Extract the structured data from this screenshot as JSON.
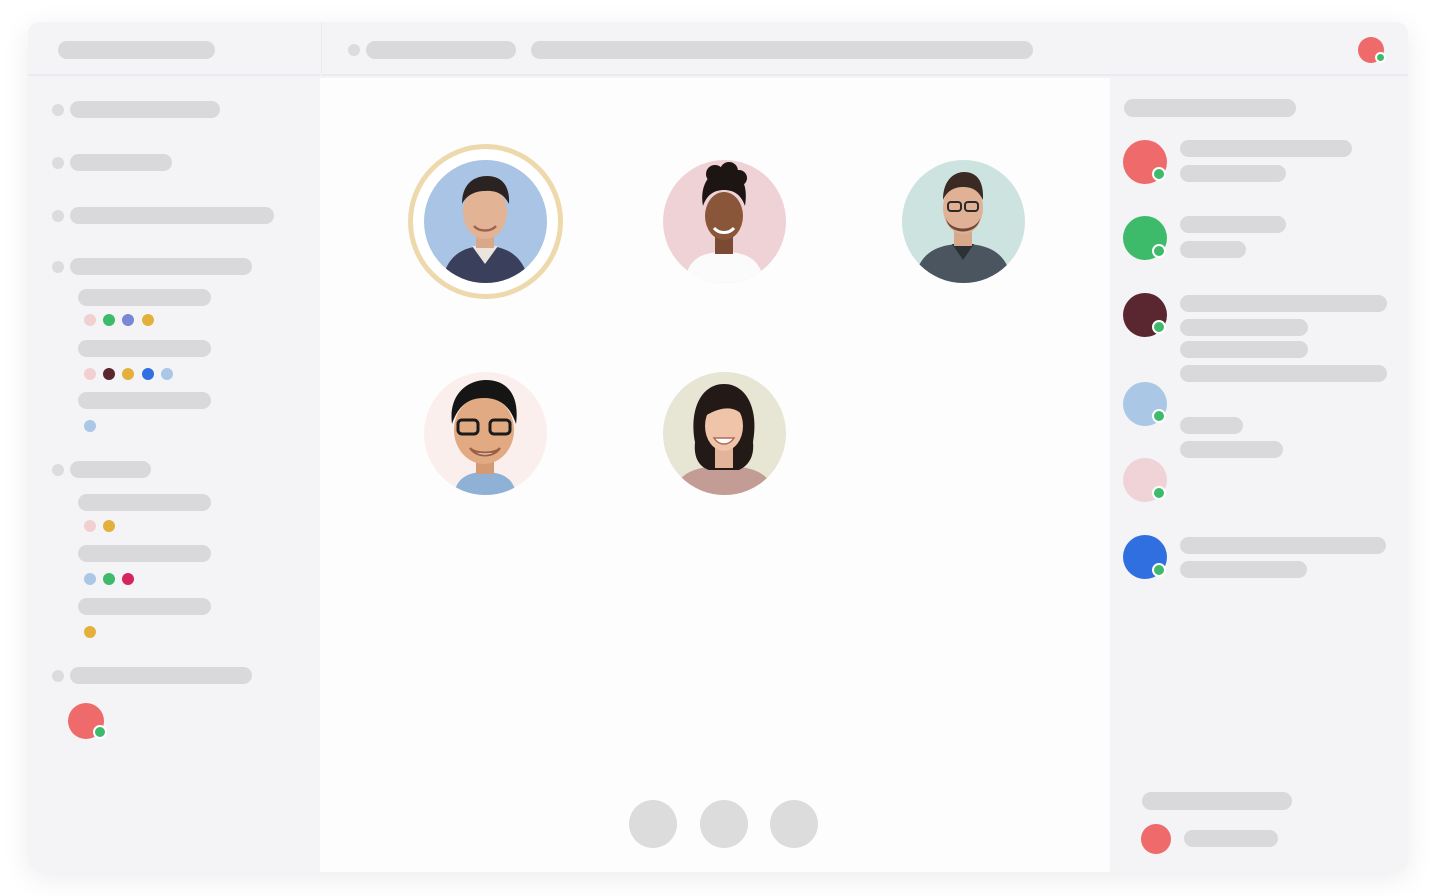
{
  "colors": {
    "window_bg": "#f4f4f6",
    "stage_bg": "#fdfdfd",
    "placeholder": "#d9d9dc",
    "online": "#3dbb6b",
    "speaking_ring": "#eed9ad"
  },
  "user_avatar": {
    "color": "#ef6a6a",
    "online": true
  },
  "channels": [
    {
      "color_dots": [
        "#f2d0d2",
        "#3dbb6b",
        "#7a86d6",
        "#e3b03c"
      ]
    },
    {
      "color_dots": [
        "#f2d0d2",
        "#5a2730",
        "#e3b03c",
        "#2f6fe0",
        "#aac7e6"
      ]
    },
    {
      "color_dots": [
        "#aac7e6"
      ]
    },
    {
      "color_dots": [
        "#f2d0d2",
        "#e3b03c"
      ]
    },
    {
      "color_dots": [
        "#aac7e6",
        "#3dbb6b",
        "#d7245c"
      ]
    },
    {
      "color_dots": [
        "#e3b03c"
      ]
    }
  ],
  "participants": [
    {
      "name_icon": "participant-1-photo",
      "bg": "#a9c4e4",
      "speaking": true
    },
    {
      "name_icon": "participant-2-photo",
      "bg": "#efd2d5",
      "speaking": false
    },
    {
      "name_icon": "participant-3-photo",
      "bg": "#cde3df",
      "speaking": false
    },
    {
      "name_icon": "participant-4-photo",
      "bg": "#fbefee",
      "speaking": false
    },
    {
      "name_icon": "participant-5-photo",
      "bg": "#e7e6d4",
      "speaking": false
    }
  ],
  "members": [
    {
      "color": "#ef6a6a",
      "online": true
    },
    {
      "color": "#3dbb6b",
      "online": true
    },
    {
      "color": "#5a2730",
      "online": true
    },
    {
      "color": "#aac7e6",
      "online": true
    },
    {
      "color": "#f0d3d6",
      "online": true
    },
    {
      "color": "#2f6fe0",
      "online": true
    }
  ],
  "footer_avatar": {
    "color": "#ef6a6a"
  },
  "controls": [
    "mic-button",
    "camera-button",
    "leave-button"
  ]
}
